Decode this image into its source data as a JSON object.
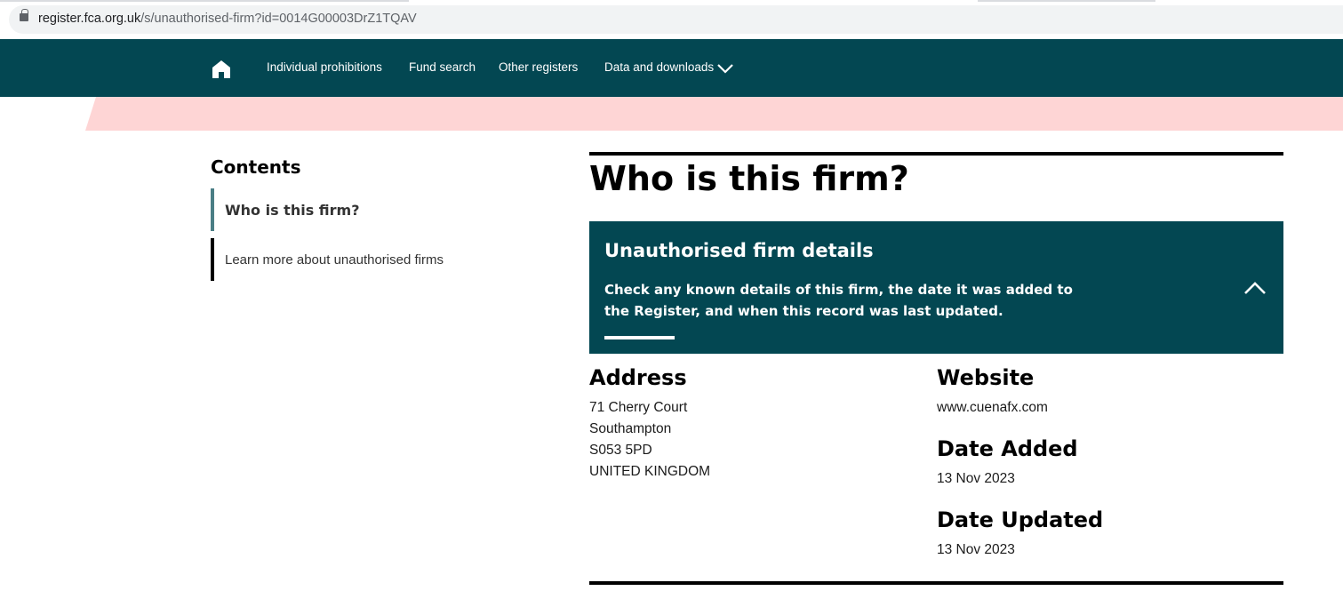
{
  "browser": {
    "url_host": "register.fca.org.uk",
    "url_path": "/s/unauthorised-firm?id=0014G00003DrZ1TQAV"
  },
  "nav": {
    "items": [
      {
        "label": "Individual prohibitions"
      },
      {
        "label": "Fund search"
      },
      {
        "label": "Other registers"
      },
      {
        "label": "Data and downloads"
      }
    ]
  },
  "sidebar": {
    "title": "Contents",
    "items": [
      {
        "label": "Who is this firm?",
        "active": true
      },
      {
        "label": "Learn more about unauthorised firms",
        "active": false
      }
    ]
  },
  "main": {
    "title": "Who is this firm?",
    "panel": {
      "title": "Unauthorised firm details",
      "description": "Check any known details of this firm, the date it was added to the Register, and when this record was last updated."
    },
    "address": {
      "heading": "Address",
      "lines": [
        "71 Cherry Court",
        "Southampton",
        "S053 5PD",
        "UNITED KINGDOM"
      ]
    },
    "website": {
      "heading": "Website",
      "value": "www.cuenafx.com"
    },
    "date_added": {
      "heading": "Date Added",
      "value": "13 Nov 2023"
    },
    "date_updated": {
      "heading": "Date Updated",
      "value": "13 Nov 2023"
    }
  },
  "colors": {
    "nav_bg": "#034752",
    "band": "#fed5d5",
    "active_bar": "#4a7e85"
  }
}
